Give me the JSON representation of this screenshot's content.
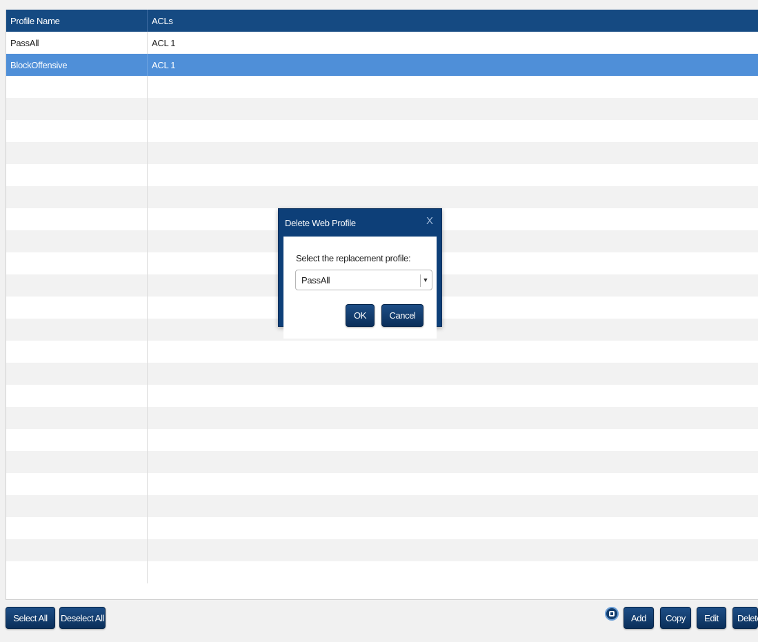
{
  "grid": {
    "columns": [
      "Profile Name",
      "ACLs"
    ],
    "rows": [
      {
        "name": "PassAll",
        "acls": "ACL 1",
        "selected": false
      },
      {
        "name": "BlockOffensive",
        "acls": "ACL 1",
        "selected": true
      }
    ],
    "empty_row_count": 23
  },
  "dialog": {
    "title": "Delete Web Profile",
    "close_glyph": "X",
    "label": "Select the replacement profile:",
    "select_value": "PassAll",
    "select_arrow": "▼",
    "ok_label": "OK",
    "cancel_label": "Cancel"
  },
  "toolbar": {
    "select_all_label": "Select All",
    "deselect_all_label": "Deselect All",
    "add_label": "Add",
    "copy_label": "Copy",
    "edit_label": "Edit",
    "delete_label": "Delete"
  },
  "colors": {
    "header": "#154a82",
    "selected_row": "#4f8fd8",
    "button": "#0b2f5a",
    "dialog_frame": "#0d3f78"
  }
}
